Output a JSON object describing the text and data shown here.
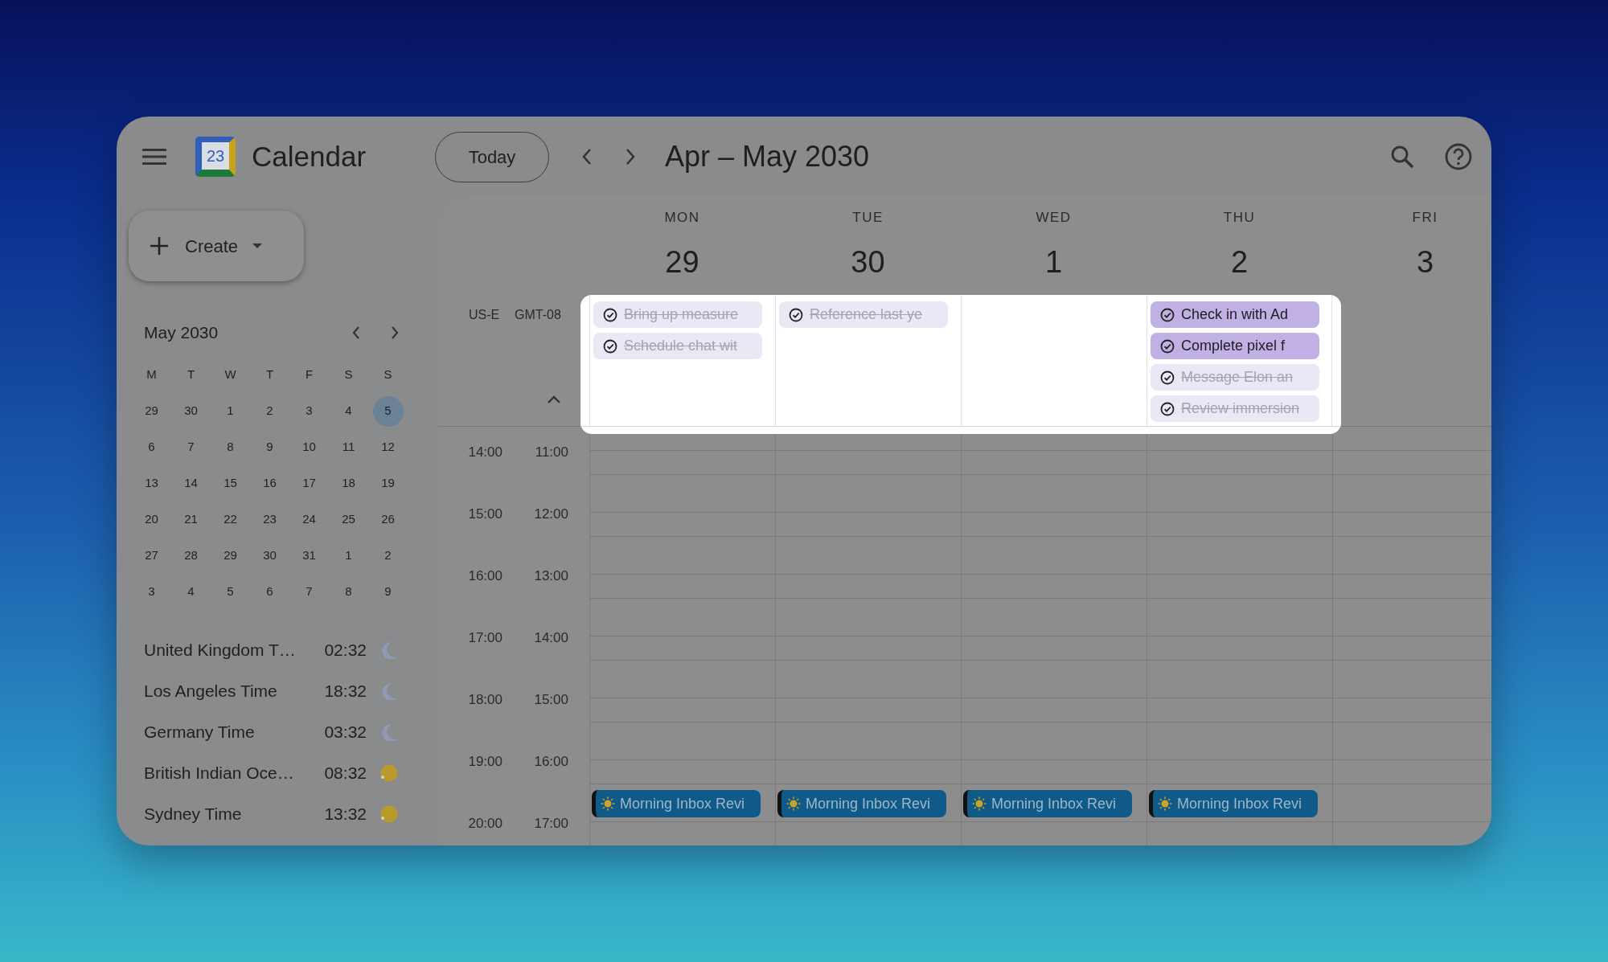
{
  "header": {
    "title": "Calendar",
    "logo_number": "23",
    "today_button": "Today",
    "date_range": "Apr – May 2030"
  },
  "create_button": {
    "label": "Create"
  },
  "mini_calendar": {
    "title": "May 2030",
    "weekdays": [
      "M",
      "T",
      "W",
      "T",
      "F",
      "S",
      "S"
    ],
    "weeks": [
      [
        {
          "day": "29",
          "selected": false
        },
        {
          "day": "30",
          "selected": false
        },
        {
          "day": "1",
          "selected": false
        },
        {
          "day": "2",
          "selected": false
        },
        {
          "day": "3",
          "selected": false
        },
        {
          "day": "4",
          "selected": false
        },
        {
          "day": "5",
          "selected": true
        }
      ],
      [
        {
          "day": "6",
          "selected": false
        },
        {
          "day": "7",
          "selected": false
        },
        {
          "day": "8",
          "selected": false
        },
        {
          "day": "9",
          "selected": false
        },
        {
          "day": "10",
          "selected": false
        },
        {
          "day": "11",
          "selected": false
        },
        {
          "day": "12",
          "selected": false
        }
      ],
      [
        {
          "day": "13",
          "selected": false
        },
        {
          "day": "14",
          "selected": false
        },
        {
          "day": "15",
          "selected": false
        },
        {
          "day": "16",
          "selected": false
        },
        {
          "day": "17",
          "selected": false
        },
        {
          "day": "18",
          "selected": false
        },
        {
          "day": "19",
          "selected": false
        }
      ],
      [
        {
          "day": "20",
          "selected": false
        },
        {
          "day": "21",
          "selected": false
        },
        {
          "day": "22",
          "selected": false
        },
        {
          "day": "23",
          "selected": false
        },
        {
          "day": "24",
          "selected": false
        },
        {
          "day": "25",
          "selected": false
        },
        {
          "day": "26",
          "selected": false
        }
      ],
      [
        {
          "day": "27",
          "selected": false
        },
        {
          "day": "28",
          "selected": false
        },
        {
          "day": "29",
          "selected": false
        },
        {
          "day": "30",
          "selected": false
        },
        {
          "day": "31",
          "selected": false
        },
        {
          "day": "1",
          "selected": false
        },
        {
          "day": "2",
          "selected": false
        }
      ],
      [
        {
          "day": "3",
          "selected": false
        },
        {
          "day": "4",
          "selected": false
        },
        {
          "day": "5",
          "selected": false
        },
        {
          "day": "6",
          "selected": false
        },
        {
          "day": "7",
          "selected": false
        },
        {
          "day": "8",
          "selected": false
        },
        {
          "day": "9",
          "selected": false
        }
      ]
    ]
  },
  "world_clocks": [
    {
      "name": "United Kingdom T…",
      "time": "02:32",
      "kind": "night"
    },
    {
      "name": "Los Angeles Time",
      "time": "18:32",
      "kind": "night"
    },
    {
      "name": "Germany Time",
      "time": "03:32",
      "kind": "night"
    },
    {
      "name": "British Indian Oce…",
      "time": "08:32",
      "kind": "day"
    },
    {
      "name": "Sydney Time",
      "time": "13:32",
      "kind": "day"
    }
  ],
  "week": {
    "timezones": [
      "US-E",
      "GMT-08"
    ],
    "days": [
      {
        "weekday": "MON",
        "date": "29",
        "tasks": [
          {
            "title": "Bring up measure",
            "done": true
          },
          {
            "title": "Schedule chat wit",
            "done": true
          }
        ],
        "events": [
          {
            "title": "Morning Inbox Revi"
          }
        ]
      },
      {
        "weekday": "TUE",
        "date": "30",
        "tasks": [
          {
            "title": "Reference last ye",
            "done": true
          }
        ],
        "events": [
          {
            "title": "Morning Inbox Revi"
          }
        ]
      },
      {
        "weekday": "WED",
        "date": "1",
        "events": [
          {
            "title": "Morning Inbox Revi"
          }
        ]
      },
      {
        "weekday": "THU",
        "date": "2",
        "tasks": [
          {
            "title": "Check in with Ad",
            "done": false
          },
          {
            "title": "Complete pixel f",
            "done": false
          },
          {
            "title": "Message Elon an",
            "done": true
          },
          {
            "title": "Review immersion",
            "done": true
          }
        ],
        "events": [
          {
            "title": "Morning Inbox Revi"
          }
        ]
      },
      {
        "weekday": "FRI",
        "date": "3"
      }
    ],
    "hours": [
      {
        "primary": "14:00",
        "secondary": "11:00"
      },
      {
        "primary": "15:00",
        "secondary": "12:00"
      },
      {
        "primary": "16:00",
        "secondary": "13:00"
      },
      {
        "primary": "17:00",
        "secondary": "14:00"
      },
      {
        "primary": "18:00",
        "secondary": "15:00"
      },
      {
        "primary": "19:00",
        "secondary": "16:00"
      },
      {
        "primary": "20:00",
        "secondary": "17:00"
      }
    ]
  }
}
